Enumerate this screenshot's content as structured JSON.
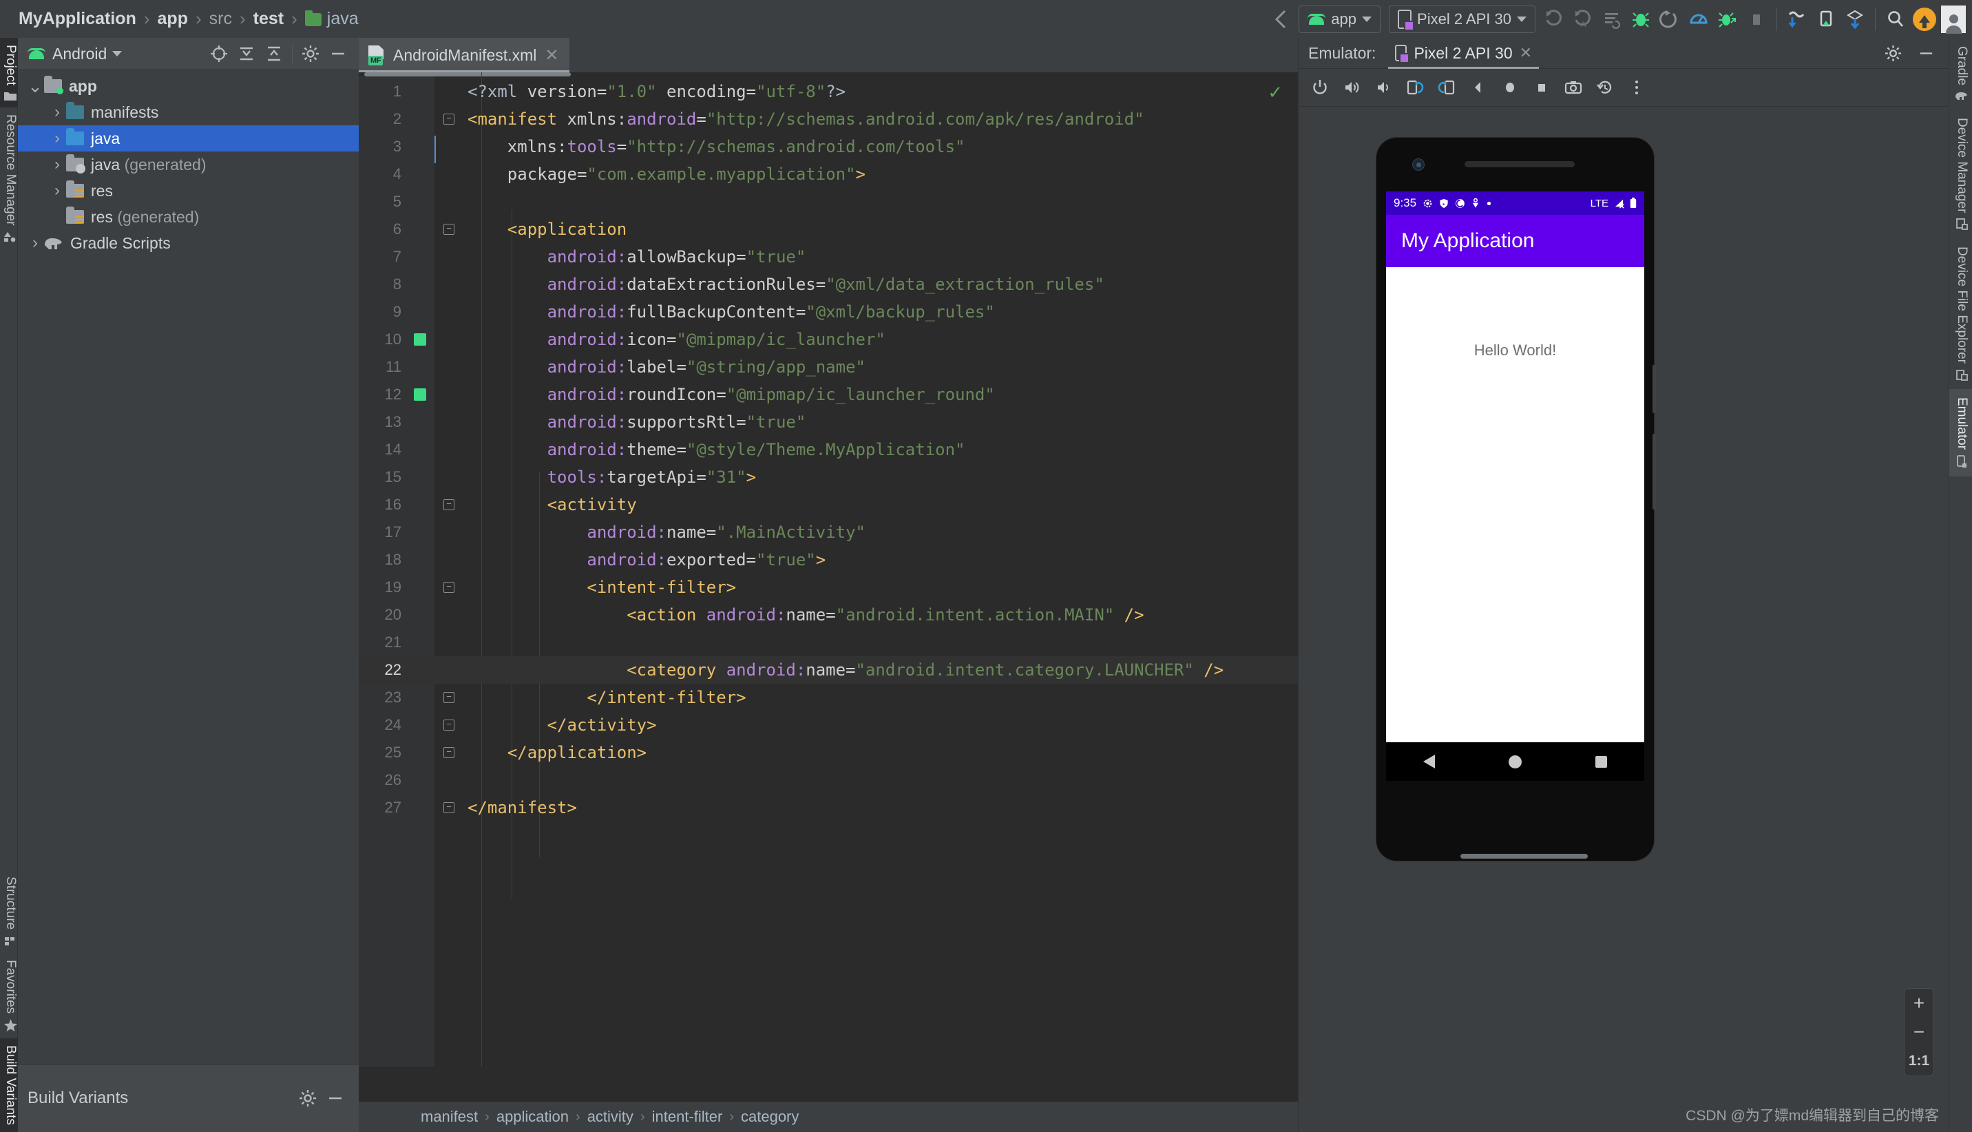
{
  "window": {
    "breadcrumb": [
      {
        "label": "MyApplication",
        "style": "bold"
      },
      {
        "label": "app",
        "style": "bold"
      },
      {
        "label": "src",
        "style": "dim"
      },
      {
        "label": "test",
        "style": "bold"
      },
      {
        "label": "java",
        "style": "folder"
      }
    ]
  },
  "toolbar": {
    "back_icon": "back-arrow-icon",
    "module_selector": {
      "label": "app",
      "icon": "android-head-icon"
    },
    "device_selector": {
      "label": "Pixel 2 API 30",
      "icon": "phone-icon"
    },
    "buttons": [
      {
        "name": "run-button",
        "icon": "run-play-icon"
      },
      {
        "name": "run-with-coverage-button",
        "icon": "coverage-icon"
      },
      {
        "name": "apply-changes-button",
        "icon": "apply-changes-icon"
      },
      {
        "name": "debug-button",
        "icon": "debug-bug-icon"
      },
      {
        "name": "rerun-button",
        "icon": "rerun-icon"
      },
      {
        "name": "profiler-button",
        "icon": "profiler-icon"
      },
      {
        "name": "attach-debugger-button",
        "icon": "attach-debugger-icon"
      },
      {
        "name": "stop-button",
        "icon": "stop-square-icon"
      },
      {
        "name": "sync-gradle-button",
        "icon": "sync-gradle-icon"
      },
      {
        "name": "avd-manager-button",
        "icon": "avd-manager-icon"
      },
      {
        "name": "sdk-manager-button",
        "icon": "sdk-manager-icon"
      },
      {
        "name": "search-button",
        "icon": "search-icon"
      },
      {
        "name": "update-button",
        "icon": "update-arrow-icon"
      },
      {
        "name": "account-button",
        "icon": "avatar-icon"
      }
    ]
  },
  "left_rail": {
    "items": [
      {
        "label": "Project",
        "icon": "folder-icon",
        "selected": true
      },
      {
        "label": "Resource Manager",
        "icon": "shapes-icon",
        "selected": false
      }
    ],
    "bottom_items": [
      {
        "label": "Structure",
        "icon": "structure-icon",
        "selected": false
      },
      {
        "label": "Favorites",
        "icon": "star-icon",
        "selected": false
      },
      {
        "label": "Build Variants",
        "icon": "",
        "selected": true
      }
    ]
  },
  "project_panel": {
    "title": "Android",
    "title_icon": "android-head-icon",
    "header_buttons": [
      {
        "name": "dropdown-caret",
        "icon": "chevron-down-icon"
      },
      {
        "name": "select-opened-file-button",
        "icon": "target-icon"
      },
      {
        "name": "expand-all-button",
        "icon": "expand-all-icon"
      },
      {
        "name": "collapse-all-button",
        "icon": "collapse-all-icon"
      },
      {
        "name": "settings-button",
        "icon": "gear-icon"
      },
      {
        "name": "hide-button",
        "icon": "minimize-icon"
      }
    ],
    "tree": [
      {
        "label": "app",
        "indent": 0,
        "twisty": "expanded",
        "icon": "module-folder-icon",
        "bold": true,
        "selected": false
      },
      {
        "label": "manifests",
        "indent": 1,
        "twisty": "collapsed",
        "icon": "folder-teal-icon",
        "bold": false,
        "selected": false
      },
      {
        "label": "java",
        "indent": 1,
        "twisty": "collapsed",
        "icon": "folder-blue-icon",
        "bold": false,
        "selected": true
      },
      {
        "label": "java (generated)",
        "indent": 1,
        "twisty": "collapsed",
        "icon": "folder-generated-icon",
        "bold": false,
        "selected": false
      },
      {
        "label": "res",
        "indent": 1,
        "twisty": "collapsed",
        "icon": "folder-res-icon",
        "bold": false,
        "selected": false
      },
      {
        "label": "res (generated)",
        "indent": 1,
        "twisty": "none",
        "icon": "folder-res-icon",
        "bold": false,
        "selected": false
      },
      {
        "label": "Gradle Scripts",
        "indent": 0,
        "twisty": "collapsed",
        "icon": "gradle-elephant-icon",
        "bold": false,
        "selected": false
      }
    ]
  },
  "build_variants": {
    "title": "Build Variants",
    "settings_icon": "gear-icon",
    "minimize_icon": "minimize-icon"
  },
  "editor": {
    "tab": {
      "label": "AndroidManifest.xml",
      "icon": "manifest-file-icon",
      "badge": "MF",
      "close_icon": "close-icon"
    },
    "inspection_status_icon": "checkmark-icon",
    "lines": [
      {
        "n": "1",
        "fold": "",
        "marker": false,
        "indent": 0,
        "tokens": [
          {
            "t": "plain",
            "v": "<?xml "
          },
          {
            "t": "attr",
            "v": "version"
          },
          {
            "t": "eq",
            "v": "="
          },
          {
            "t": "str",
            "v": "\"1.0\""
          },
          {
            "t": "plain",
            "v": " "
          },
          {
            "t": "attr",
            "v": "encoding"
          },
          {
            "t": "eq",
            "v": "="
          },
          {
            "t": "str",
            "v": "\"utf-8\""
          },
          {
            "t": "plain",
            "v": "?>"
          }
        ]
      },
      {
        "n": "2",
        "fold": "minus",
        "marker": false,
        "indent": 0,
        "tokens": [
          {
            "t": "tag",
            "v": "<manifest"
          },
          {
            "t": "plain",
            "v": " "
          },
          {
            "t": "attr",
            "v": "xmlns:"
          },
          {
            "t": "ns",
            "v": "android"
          },
          {
            "t": "eq",
            "v": "="
          },
          {
            "t": "str",
            "v": "\"http://schemas.android.com/apk/res/android\""
          }
        ]
      },
      {
        "n": "3",
        "fold": "",
        "marker": false,
        "indent": 1,
        "tokens": [
          {
            "t": "attr",
            "v": "xmlns:"
          },
          {
            "t": "ns",
            "v": "tools"
          },
          {
            "t": "eq",
            "v": "="
          },
          {
            "t": "str",
            "v": "\"http://schemas.android.com/tools\""
          }
        ]
      },
      {
        "n": "4",
        "fold": "",
        "marker": false,
        "indent": 1,
        "tokens": [
          {
            "t": "attr",
            "v": "package"
          },
          {
            "t": "eq",
            "v": "="
          },
          {
            "t": "str",
            "v": "\"com.example.myapplication\""
          },
          {
            "t": "tag",
            "v": ">"
          }
        ]
      },
      {
        "n": "5",
        "fold": "",
        "marker": false,
        "indent": 0,
        "tokens": []
      },
      {
        "n": "6",
        "fold": "minus",
        "marker": false,
        "indent": 1,
        "tokens": [
          {
            "t": "tag",
            "v": "<application"
          }
        ]
      },
      {
        "n": "7",
        "fold": "",
        "marker": false,
        "indent": 2,
        "tokens": [
          {
            "t": "ns",
            "v": "android:"
          },
          {
            "t": "attr",
            "v": "allowBackup"
          },
          {
            "t": "eq",
            "v": "="
          },
          {
            "t": "str",
            "v": "\"true\""
          }
        ]
      },
      {
        "n": "8",
        "fold": "",
        "marker": false,
        "indent": 2,
        "tokens": [
          {
            "t": "ns",
            "v": "android:"
          },
          {
            "t": "attr",
            "v": "dataExtractionRules"
          },
          {
            "t": "eq",
            "v": "="
          },
          {
            "t": "str",
            "v": "\"@xml/data_extraction_rules\""
          }
        ]
      },
      {
        "n": "9",
        "fold": "",
        "marker": false,
        "indent": 2,
        "tokens": [
          {
            "t": "ns",
            "v": "android:"
          },
          {
            "t": "attr",
            "v": "fullBackupContent"
          },
          {
            "t": "eq",
            "v": "="
          },
          {
            "t": "str",
            "v": "\"@xml/backup_rules\""
          }
        ]
      },
      {
        "n": "10",
        "fold": "",
        "marker": true,
        "indent": 2,
        "tokens": [
          {
            "t": "ns",
            "v": "android:"
          },
          {
            "t": "attr",
            "v": "icon"
          },
          {
            "t": "eq",
            "v": "="
          },
          {
            "t": "str",
            "v": "\"@mipmap/ic_launcher\""
          }
        ]
      },
      {
        "n": "11",
        "fold": "",
        "marker": false,
        "indent": 2,
        "tokens": [
          {
            "t": "ns",
            "v": "android:"
          },
          {
            "t": "attr",
            "v": "label"
          },
          {
            "t": "eq",
            "v": "="
          },
          {
            "t": "str",
            "v": "\"@string/app_name\""
          }
        ]
      },
      {
        "n": "12",
        "fold": "",
        "marker": true,
        "indent": 2,
        "tokens": [
          {
            "t": "ns",
            "v": "android:"
          },
          {
            "t": "attr",
            "v": "roundIcon"
          },
          {
            "t": "eq",
            "v": "="
          },
          {
            "t": "str",
            "v": "\"@mipmap/ic_launcher_round\""
          }
        ]
      },
      {
        "n": "13",
        "fold": "",
        "marker": false,
        "indent": 2,
        "tokens": [
          {
            "t": "ns",
            "v": "android:"
          },
          {
            "t": "attr",
            "v": "supportsRtl"
          },
          {
            "t": "eq",
            "v": "="
          },
          {
            "t": "str",
            "v": "\"true\""
          }
        ]
      },
      {
        "n": "14",
        "fold": "",
        "marker": false,
        "indent": 2,
        "tokens": [
          {
            "t": "ns",
            "v": "android:"
          },
          {
            "t": "attr",
            "v": "theme"
          },
          {
            "t": "eq",
            "v": "="
          },
          {
            "t": "str",
            "v": "\"@style/Theme.MyApplication\""
          }
        ]
      },
      {
        "n": "15",
        "fold": "",
        "marker": false,
        "indent": 2,
        "tokens": [
          {
            "t": "ns",
            "v": "tools:"
          },
          {
            "t": "attr",
            "v": "targetApi"
          },
          {
            "t": "eq",
            "v": "="
          },
          {
            "t": "str",
            "v": "\"31\""
          },
          {
            "t": "tag",
            "v": ">"
          }
        ]
      },
      {
        "n": "16",
        "fold": "minus",
        "marker": false,
        "indent": 2,
        "tokens": [
          {
            "t": "tag",
            "v": "<activity"
          }
        ]
      },
      {
        "n": "17",
        "fold": "",
        "marker": false,
        "indent": 3,
        "tokens": [
          {
            "t": "ns",
            "v": "android:"
          },
          {
            "t": "attr",
            "v": "name"
          },
          {
            "t": "eq",
            "v": "="
          },
          {
            "t": "str",
            "v": "\".MainActivity\""
          }
        ]
      },
      {
        "n": "18",
        "fold": "",
        "marker": false,
        "indent": 3,
        "tokens": [
          {
            "t": "ns",
            "v": "android:"
          },
          {
            "t": "attr",
            "v": "exported"
          },
          {
            "t": "eq",
            "v": "="
          },
          {
            "t": "str",
            "v": "\"true\""
          },
          {
            "t": "tag",
            "v": ">"
          }
        ]
      },
      {
        "n": "19",
        "fold": "minus",
        "marker": false,
        "indent": 3,
        "tokens": [
          {
            "t": "tag",
            "v": "<intent-filter>"
          }
        ]
      },
      {
        "n": "20",
        "fold": "",
        "marker": false,
        "indent": 4,
        "tokens": [
          {
            "t": "tag",
            "v": "<action"
          },
          {
            "t": "plain",
            "v": " "
          },
          {
            "t": "ns",
            "v": "android:"
          },
          {
            "t": "attr",
            "v": "name"
          },
          {
            "t": "eq",
            "v": "="
          },
          {
            "t": "str",
            "v": "\"android.intent.action.MAIN\""
          },
          {
            "t": "plain",
            "v": " "
          },
          {
            "t": "tag",
            "v": "/>"
          }
        ]
      },
      {
        "n": "21",
        "fold": "",
        "marker": false,
        "indent": 0,
        "tokens": []
      },
      {
        "n": "22",
        "fold": "",
        "marker": false,
        "indent": 4,
        "highlight": true,
        "tokens": [
          {
            "t": "tag",
            "v": "<category"
          },
          {
            "t": "plain",
            "v": " "
          },
          {
            "t": "ns",
            "v": "android:"
          },
          {
            "t": "attr",
            "v": "name"
          },
          {
            "t": "eq",
            "v": "="
          },
          {
            "t": "str",
            "v": "\"android.intent.category.LAUNCHER\""
          },
          {
            "t": "plain",
            "v": " "
          },
          {
            "t": "tag",
            "v": "/>"
          }
        ]
      },
      {
        "n": "23",
        "fold": "plus-end",
        "marker": false,
        "indent": 3,
        "tokens": [
          {
            "t": "tag",
            "v": "</intent-filter>"
          }
        ]
      },
      {
        "n": "24",
        "fold": "plus-end",
        "marker": false,
        "indent": 2,
        "tokens": [
          {
            "t": "tag",
            "v": "</activity>"
          }
        ]
      },
      {
        "n": "25",
        "fold": "plus-end",
        "marker": false,
        "indent": 1,
        "tokens": [
          {
            "t": "tag",
            "v": "</application>"
          }
        ]
      },
      {
        "n": "26",
        "fold": "",
        "marker": false,
        "indent": 0,
        "tokens": []
      },
      {
        "n": "27",
        "fold": "plus-end",
        "marker": false,
        "indent": 0,
        "tokens": [
          {
            "t": "tag",
            "v": "</manifest>"
          }
        ]
      }
    ],
    "breadcrumbs": [
      "manifest",
      "application",
      "activity",
      "intent-filter",
      "category"
    ]
  },
  "emulator": {
    "panel_label": "Emulator:",
    "tab": {
      "label": "Pixel 2 API 30",
      "icon": "phone-icon",
      "close_icon": "close-icon"
    },
    "header_buttons": [
      {
        "name": "emulator-settings-button",
        "icon": "gear-icon"
      },
      {
        "name": "emulator-hide-button",
        "icon": "minimize-icon"
      }
    ],
    "controls": [
      {
        "name": "power-button",
        "icon": "power-icon"
      },
      {
        "name": "volume-up-button",
        "icon": "volume-up-icon"
      },
      {
        "name": "volume-down-button",
        "icon": "volume-down-icon"
      },
      {
        "name": "rotate-left-button",
        "icon": "rotate-left-icon"
      },
      {
        "name": "rotate-right-button",
        "icon": "rotate-right-icon"
      },
      {
        "name": "back-button",
        "icon": "back-triangle-icon"
      },
      {
        "name": "home-button",
        "icon": "home-circle-icon"
      },
      {
        "name": "overview-button",
        "icon": "overview-square-icon"
      },
      {
        "name": "screenshot-button",
        "icon": "camera-icon"
      },
      {
        "name": "snapshot-button",
        "icon": "history-icon"
      },
      {
        "name": "more-button",
        "icon": "more-vertical-icon"
      }
    ],
    "device_screen": {
      "status_bar": {
        "time": "9:35",
        "left_icons": [
          "gear-icon",
          "shield-icon",
          "sync-icon",
          "location-icon",
          "dot-icon"
        ],
        "network": "LTE",
        "signal_icon": "signal-off-icon",
        "battery_icon": "battery-full-icon"
      },
      "app_bar_title": "My Application",
      "app_bar_color": "#6200ee",
      "status_bar_color": "#3b00c8",
      "body_text": "Hello World!",
      "nav_buttons": [
        {
          "name": "android-back-button",
          "icon": "back-triangle-icon"
        },
        {
          "name": "android-home-button",
          "icon": "home-circle-icon"
        },
        {
          "name": "android-recents-button",
          "icon": "recents-square-icon"
        }
      ]
    },
    "zoom_controls": [
      {
        "name": "zoom-in-button",
        "label": "+"
      },
      {
        "name": "zoom-out-button",
        "label": "−"
      },
      {
        "name": "zoom-actual-button",
        "label": "1:1"
      }
    ]
  },
  "right_rail": {
    "items": [
      {
        "label": "Gradle",
        "icon": "gradle-elephant-icon",
        "selected": false
      },
      {
        "label": "Device Manager",
        "icon": "device-icon",
        "selected": false
      },
      {
        "label": "Device File Explorer",
        "icon": "device-file-icon",
        "selected": false
      },
      {
        "label": "Emulator",
        "icon": "phone-icon",
        "selected": true
      }
    ]
  },
  "watermark": "CSDN @为了嫖md编辑器到自己的博客"
}
